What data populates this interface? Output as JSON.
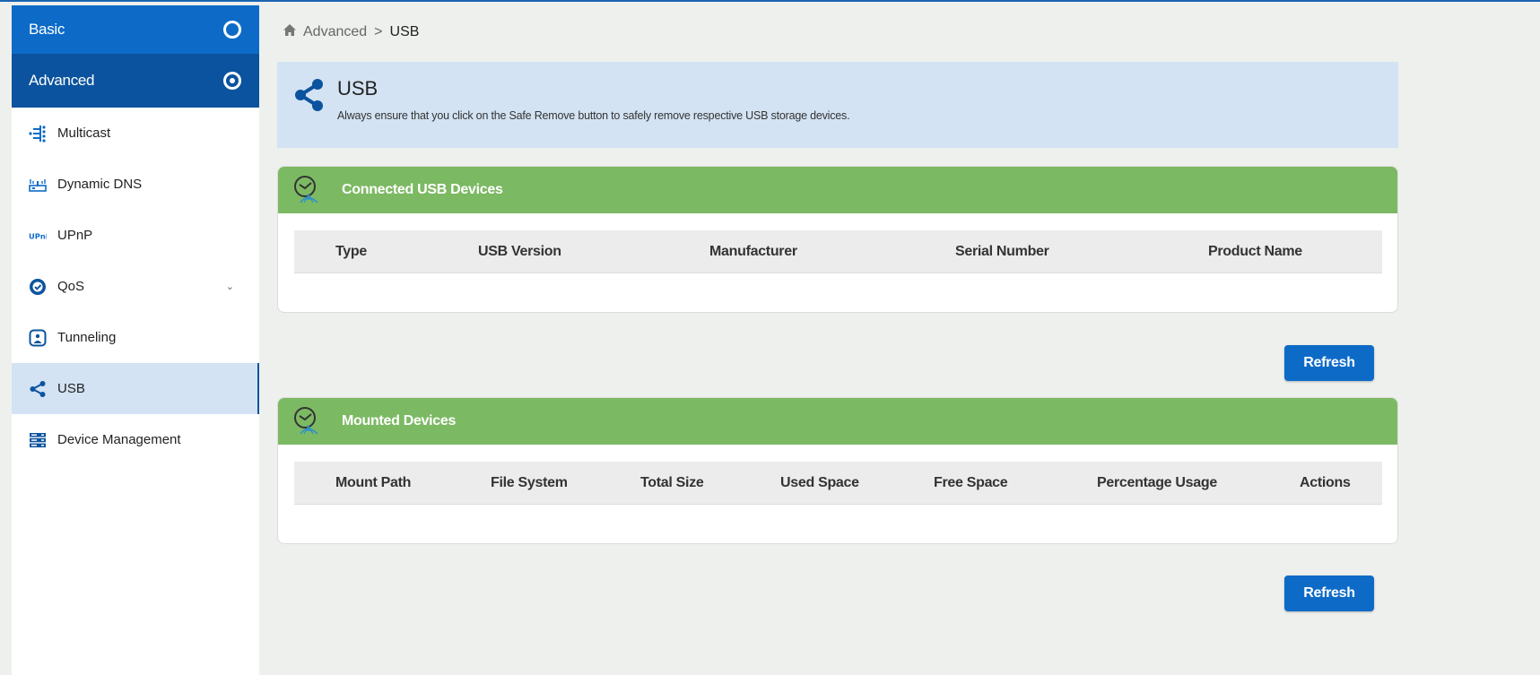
{
  "sidebar": {
    "basic_label": "Basic",
    "advanced_label": "Advanced",
    "items": [
      {
        "label": "Multicast",
        "icon": "multicast-icon"
      },
      {
        "label": "Dynamic DNS",
        "icon": "dynamic-dns-icon"
      },
      {
        "label": "UPnP",
        "icon": "upnp-icon"
      },
      {
        "label": "QoS",
        "icon": "qos-icon"
      },
      {
        "label": "Tunneling",
        "icon": "tunneling-icon"
      },
      {
        "label": "USB",
        "icon": "share-icon"
      },
      {
        "label": "Device Management",
        "icon": "device-management-icon"
      }
    ],
    "active_item": "USB"
  },
  "breadcrumb": {
    "home_icon": "home-icon",
    "parent": "Advanced",
    "separator": ">",
    "current": "USB"
  },
  "banner": {
    "title": "USB",
    "description": "Always ensure that you click on the Safe Remove button to safely remove respective USB storage devices."
  },
  "connected_devices": {
    "title": "Connected USB Devices",
    "columns": [
      "Type",
      "USB Version",
      "Manufacturer",
      "Serial Number",
      "Product Name"
    ],
    "rows": [],
    "refresh_label": "Refresh"
  },
  "mounted_devices": {
    "title": "Mounted Devices",
    "columns": [
      "Mount Path",
      "File System",
      "Total Size",
      "Used Space",
      "Free Space",
      "Percentage Usage",
      "Actions"
    ],
    "rows": [],
    "refresh_label": "Refresh"
  },
  "colors": {
    "primary": "#0d6bc7",
    "primary_dark": "#0b539e",
    "card_header": "#7cb963",
    "banner": "#d3e3f3"
  }
}
